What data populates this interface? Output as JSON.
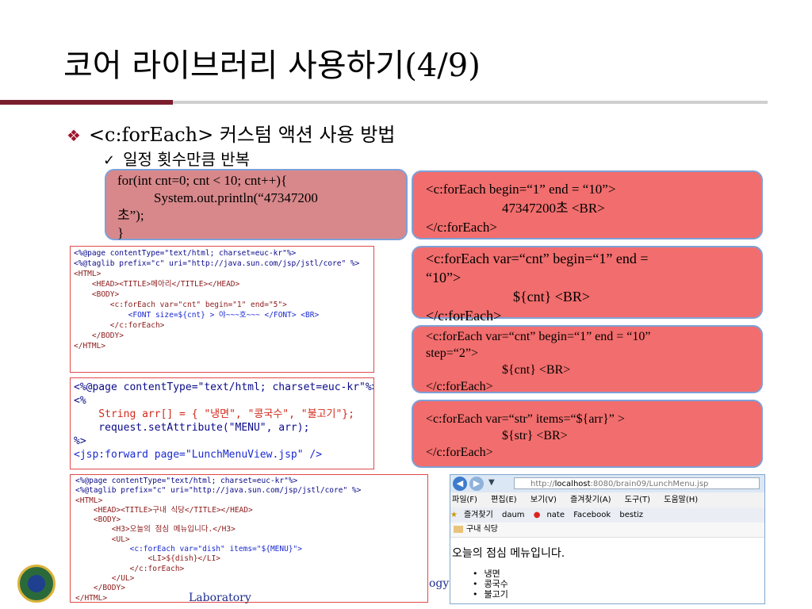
{
  "slide": {
    "title": "코어 라이브러리 사용하기(4/9)",
    "bullet1": "<c:forEach> 커스텀 액션 사용 방법",
    "bullet2": "일정 횟수만큼 반복"
  },
  "code_box": {
    "lines": [
      "for(int cnt=0; cnt < 10; cnt++){",
      "System.out.println(“47347200",
      "초”);",
      "}"
    ]
  },
  "boxes": {
    "box1": [
      "<c:forEach begin=“1” end = “10”>",
      "47347200초   <BR>",
      "</c:forEach>"
    ],
    "box2": [
      "<c:forEach var=“cnt” begin=“1” end =",
      "“10”>",
      "${cnt}  <BR>",
      "</c:forEach>"
    ],
    "box3": [
      "<c:forEach var=“cnt” begin=“1” end = “10”",
      "step=“2”>",
      "${cnt}  <BR>",
      "</c:forEach>"
    ],
    "box4": [
      "<c:forEach var=“str” items=“${arr}” >",
      "${str}  <BR>",
      "</c:forEach>"
    ]
  },
  "shot1": [
    "<%@page contentType=\"text/html; charset=euc-kr\"%>",
    "<%@taglib prefix=\"c\" uri=\"http://java.sun.com/jsp/jstl/core\" %>",
    "<HTML>",
    "    <HEAD><TITLE>메아리</TITLE></HEAD>",
    "    <BODY>",
    "        <c:forEach var=\"cnt\" begin=\"1\" end=\"5\">",
    "            <FONT size=${cnt} > 야~~~호~~~ </FONT> <BR>",
    "        </c:forEach>",
    "    </BODY>",
    "</HTML>"
  ],
  "shot2": [
    "<%@page contentType=\"text/html; charset=euc-kr\"%>",
    "<%",
    "    String arr[] = { \"냉면\", \"콩국수\", \"불고기\"};",
    "    request.setAttribute(\"MENU\", arr);",
    "%>",
    "<jsp:forward page=\"LunchMenuView.jsp\" />"
  ],
  "shot3": [
    "<%@page contentType=\"text/html; charset=euc-kr\"%>",
    "<%@taglib prefix=\"c\" uri=\"http://java.sun.com/jsp/jstl/core\" %>",
    "<HTML>",
    "    <HEAD><TITLE>구내 식당</TITLE></HEAD>",
    "    <BODY>",
    "        <H3>오늘의 점심 메뉴입니다.</H3>",
    "        <UL>",
    "            <c:forEach var=\"dish\" items=\"${MENU}\">",
    "                <LI>${dish}</LI>",
    "            </c:forEach>",
    "        </UL>",
    "    </BODY>",
    "</HTML>"
  ],
  "browser": {
    "url_prefix": "http://",
    "url_host": "localhost",
    "url_rest": ":8080/brain09/LunchMenu.jsp",
    "menus": [
      "파일(F)",
      "편집(E)",
      "보기(V)",
      "즐겨찾기(A)",
      "도구(T)",
      "도움말(H)"
    ],
    "favorites": [
      "즐겨찾기",
      "daum",
      "nate",
      "Facebook",
      "bestiz"
    ],
    "tab_title": "구내 식당",
    "heading": "오늘의 점심 메뉴입니다.",
    "items": [
      "냉면",
      "콩국수",
      "불고기"
    ]
  },
  "footer": {
    "lab": "Laboratory",
    "frag": "ogy"
  },
  "colors": {
    "accent_bar": "#7a1e2e",
    "box_pink": "#f26d6d",
    "box_border": "#7ea0d6",
    "code_box_bg": "#d8888b"
  }
}
